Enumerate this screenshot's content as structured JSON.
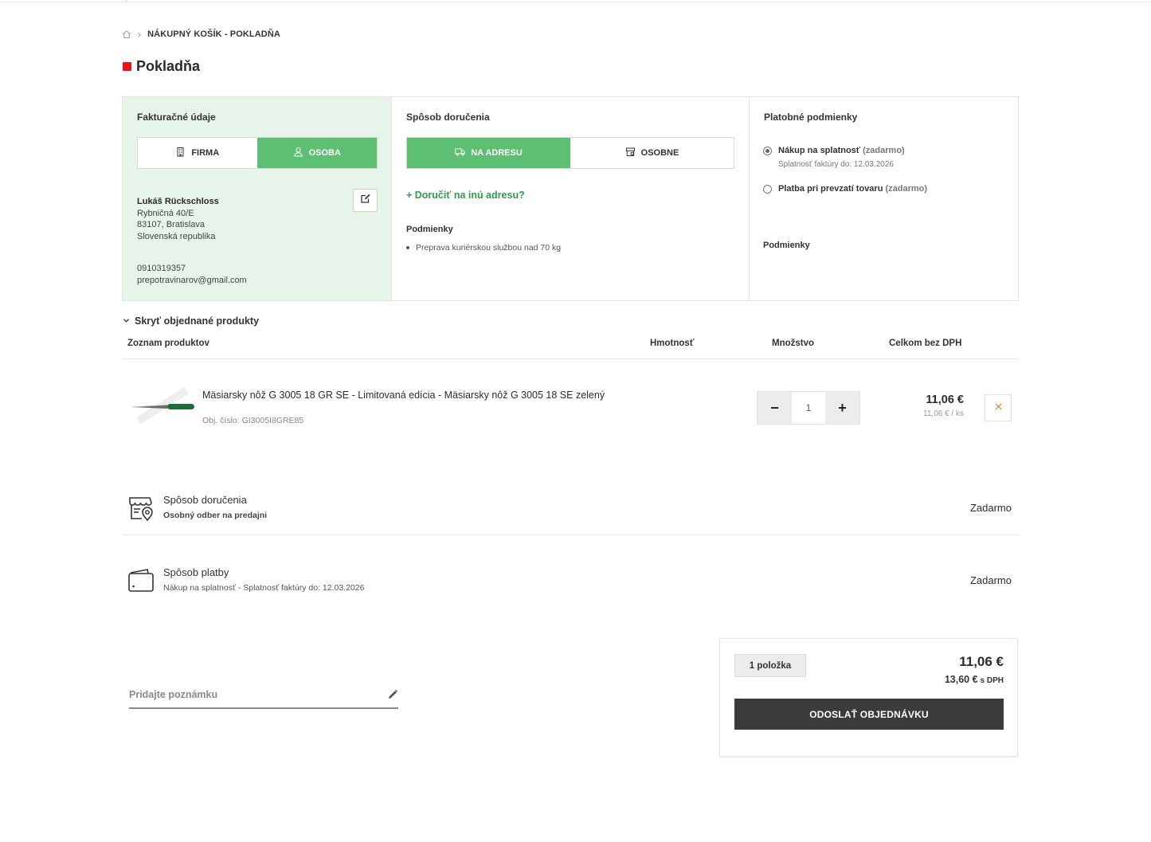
{
  "breadcrumb": {
    "current": "NÁKUPNÝ KOŠÍK - POKLADŇA"
  },
  "page": {
    "title": "Pokladňa"
  },
  "billing": {
    "title": "Fakturačné údaje",
    "option_company": "FIRMA",
    "option_person": "OSOBA",
    "name": "Lukáš Rückschloss",
    "street": "Rybničná 40/E",
    "city": "83107, Bratislava",
    "country": "Slovenská republika",
    "phone": "0910319357",
    "email": "prepotravinarov@gmail.com"
  },
  "delivery": {
    "title": "Spôsob doručenia",
    "option_address": "NA ADRESU",
    "option_personal": "OSOBNE",
    "other_address": "+ Doručiť na inú adresu?",
    "conditions_title": "Podmienky",
    "conditions": [
      "Preprava kuriérskou službou nad 70 kg"
    ]
  },
  "payment": {
    "title": "Platobné podmienky",
    "option1_label": "Nákup na splatnosť",
    "option1_free": "(zadarmo)",
    "option1_sub": "Splatnosť faktúry do: 12.03.2026",
    "option2_label": "Platba pri prevzatí tovaru",
    "option2_free": "(zadarmo)",
    "conditions_title": "Podmienky"
  },
  "products": {
    "toggle": "Skryť objednané produkty",
    "head_list": "Zoznam produktov",
    "head_weight": "Hmotnosť",
    "head_qty": "Množstvo",
    "head_total": "Celkom bez DPH",
    "items": [
      {
        "name": "Mäsiarsky nôž G 3005 18 GR SE - Limitovaná edícia - Mäsiarsky nôž G 3005 18 SE zelený",
        "code": "Obj. číslo: GI3005I8GRE85",
        "qty": "1",
        "price": "11,06 €",
        "unit_price": "11,06 € / ks"
      }
    ]
  },
  "methods": {
    "delivery_title": "Spôsob doručenia",
    "delivery_sub": "Osobný odber na predajni",
    "delivery_price": "Zadarmo",
    "payment_title": "Spôsob platby",
    "payment_sub": "Nákup na splatnosť - Splatnosť faktúry do: 12.03.2026",
    "payment_price": "Zadarmo"
  },
  "note": {
    "placeholder": "Pridajte poznámku"
  },
  "summary": {
    "count": "1 položka",
    "total": "11,06 €",
    "total_vat": "13,60 €",
    "vat_suffix": "s DPH",
    "submit": "ODOSLAŤ OBJEDNÁVKU"
  },
  "colors": {
    "accent_green": "#5cbf72",
    "brand_red": "#e8141b",
    "link_green": "#2e9c4f",
    "dark_button": "#3b3b3b"
  }
}
